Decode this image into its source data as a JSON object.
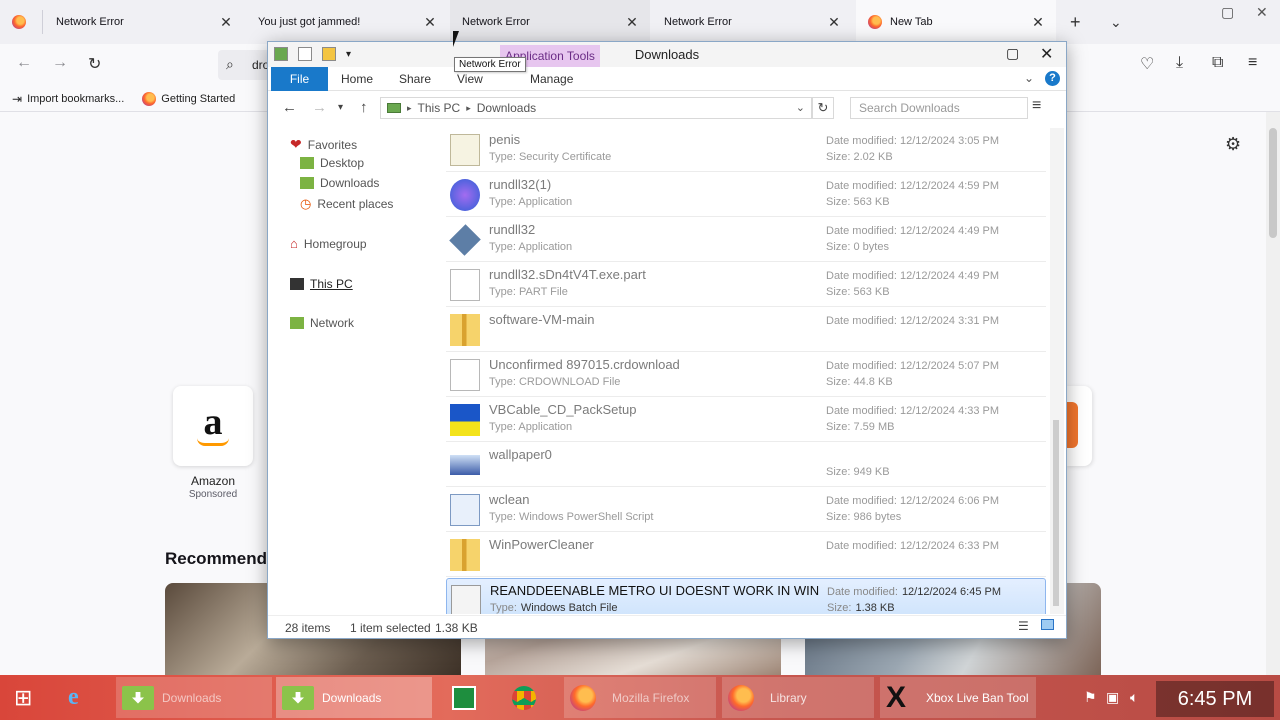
{
  "browser": {
    "tabs": [
      {
        "label": "Network Error"
      },
      {
        "label": "You just got jammed!"
      },
      {
        "label": "Network Error"
      },
      {
        "label": "Network Error"
      },
      {
        "label": "New Tab"
      }
    ],
    "url_partial": "dro",
    "bookmarks": [
      {
        "label": "Import bookmarks..."
      },
      {
        "label": "Getting Started"
      }
    ],
    "shortcut": {
      "label": "Amazon",
      "sublabel": "Sponsored"
    },
    "recommended_heading": "Recommende",
    "tooltip": "Network Error"
  },
  "explorer": {
    "title": "Downloads",
    "app_tools": "Application Tools",
    "ribbon_tabs": [
      "File",
      "Home",
      "Share",
      "View",
      "Manage"
    ],
    "breadcrumb": [
      "This PC",
      "Downloads"
    ],
    "search_placeholder": "Search Downloads",
    "nav": {
      "favorites": "Favorites",
      "desktop": "Desktop",
      "downloads": "Downloads",
      "recent": "Recent places",
      "homegroup": "Homegroup",
      "thispc": "This PC",
      "network": "Network"
    },
    "files": [
      {
        "name": "penis",
        "type": "Type: Security Certificate",
        "date": "Date modified: 12/12/2024 3:05 PM",
        "size": "Size: 2.02 KB",
        "icon": "certificate-icon"
      },
      {
        "name": "rundll32(1)",
        "type": "Type: Application",
        "date": "Date modified: 12/12/2024 4:59 PM",
        "size": "Size: 563 KB",
        "icon": "application-icon"
      },
      {
        "name": "rundll32",
        "type": "Type: Application",
        "date": "Date modified: 12/12/2024 4:49 PM",
        "size": "Size: 0 bytes",
        "icon": "diamond-app-icon"
      },
      {
        "name": "rundll32.sDn4tV4T.exe.part",
        "type": "Type: PART File",
        "date": "Date modified: 12/12/2024 4:49 PM",
        "size": "Size: 563 KB",
        "icon": "blank-file-icon"
      },
      {
        "name": "software-VM-main",
        "type": "",
        "date": "Date modified: 12/12/2024 3:31 PM",
        "size": "",
        "icon": "zip-folder-icon"
      },
      {
        "name": "Unconfirmed 897015.crdownload",
        "type": "Type: CRDOWNLOAD File",
        "date": "Date modified: 12/12/2024 5:07 PM",
        "size": "Size: 44.8 KB",
        "icon": "blank-file-icon"
      },
      {
        "name": "VBCable_CD_PackSetup",
        "type": "Type: Application",
        "date": "Date modified: 12/12/2024 4:33 PM",
        "size": "Size: 7.59 MB",
        "icon": "installer-icon"
      },
      {
        "name": "wallpaper0",
        "type": "",
        "date": "",
        "size": "Size: 949 KB",
        "icon": "image-file-icon"
      },
      {
        "name": "wclean",
        "type": "Type: Windows PowerShell Script",
        "date": "Date modified: 12/12/2024 6:06 PM",
        "size": "Size: 986 bytes",
        "icon": "powershell-icon"
      },
      {
        "name": "WinPowerCleaner",
        "type": "",
        "date": "Date modified: 12/12/2024 6:33 PM",
        "size": "",
        "icon": "zip-folder-icon"
      },
      {
        "name": "REANDDEENABLE METRO UI DOESNT WORK IN WIN...",
        "type": "Windows Batch File",
        "type_label": "Type:",
        "date": "12/12/2024 6:45 PM",
        "date_label": "Date modified:",
        "size": "1.38 KB",
        "size_label": "Size:",
        "icon": "batch-file-icon",
        "selected": true
      }
    ],
    "status": {
      "items": "28 items",
      "selected": "1 item selected",
      "size": "1.38 KB"
    }
  },
  "taskbar": {
    "buttons": [
      "Downloads",
      "Downloads",
      "Mozilla Firefox",
      "Library",
      "Xbox Live Ban Tool"
    ],
    "time": "6:45 PM"
  },
  "colors": {
    "file_tab": "#1979ca",
    "app_tools": "#e7c6ef",
    "taskbar": "#d9463a",
    "selection": "#cde3fc"
  }
}
